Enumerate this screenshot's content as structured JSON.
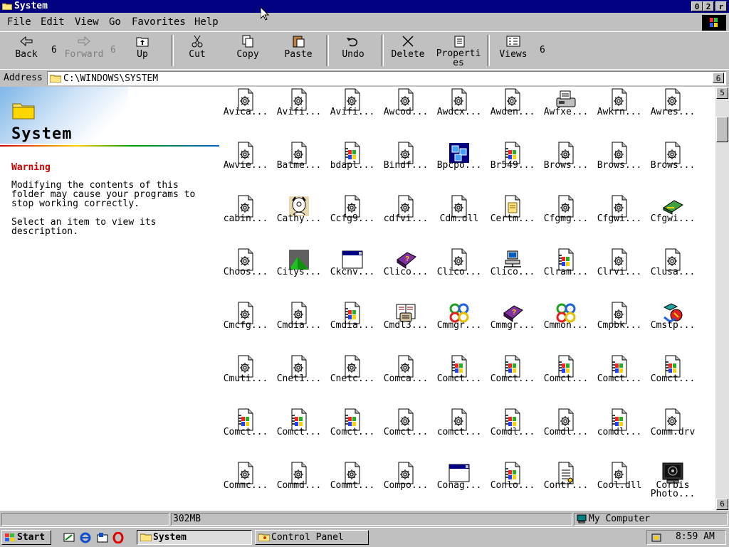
{
  "window": {
    "title": "System",
    "controls": [
      "0",
      "2",
      "r"
    ]
  },
  "menu": [
    "File",
    "Edit",
    "View",
    "Go",
    "Favorites",
    "Help"
  ],
  "toolbar": {
    "back": "Back",
    "back_arrow": "6",
    "forward": "Forward",
    "forward_arrow": "6",
    "up": "Up",
    "cut": "Cut",
    "copy": "Copy",
    "paste": "Paste",
    "undo": "Undo",
    "delete": "Delete",
    "properties": "Properties",
    "views": "Views",
    "views_arrow": "6"
  },
  "address": {
    "label": "Address",
    "path": "C:\\WINDOWS\\SYSTEM",
    "dropdown": "6"
  },
  "side_panel": {
    "title": "System",
    "warning_label": "Warning",
    "warning_text": "Modifying the contents of this folder may cause your programs to stop working correctly.",
    "hint_text": "Select an item to view its description."
  },
  "files": [
    {
      "name": "Avica...",
      "icon": "gear-doc"
    },
    {
      "name": "Avifi...",
      "icon": "gear-doc"
    },
    {
      "name": "Avifi...",
      "icon": "gear-doc"
    },
    {
      "name": "Awcod...",
      "icon": "gear-doc"
    },
    {
      "name": "Awdcx...",
      "icon": "gear-doc"
    },
    {
      "name": "Awden...",
      "icon": "gear-doc"
    },
    {
      "name": "Awfxe...",
      "icon": "fax"
    },
    {
      "name": "Awkrn...",
      "icon": "gear-doc"
    },
    {
      "name": "Awres...",
      "icon": "gear-doc"
    },
    {
      "name": "Awvie...",
      "icon": "gear-doc"
    },
    {
      "name": "Batme...",
      "icon": "gear-doc"
    },
    {
      "name": "bdapl...",
      "icon": "win-doc"
    },
    {
      "name": "Bindf...",
      "icon": "gear-doc"
    },
    {
      "name": "Bpcpo...",
      "icon": "blue-cubes"
    },
    {
      "name": "Br549...",
      "icon": "win-doc"
    },
    {
      "name": "Brows...",
      "icon": "gear-doc"
    },
    {
      "name": "Brows...",
      "icon": "gear-doc"
    },
    {
      "name": "Brows...",
      "icon": "gear-doc"
    },
    {
      "name": "cabin...",
      "icon": "gear-doc"
    },
    {
      "name": "Cathy...",
      "icon": "cathy"
    },
    {
      "name": "Ccfg9...",
      "icon": "gear-doc"
    },
    {
      "name": "cdfvi...",
      "icon": "gear-doc"
    },
    {
      "name": "Cdm.dll",
      "icon": "gear-doc"
    },
    {
      "name": "Certm...",
      "icon": "cert-doc"
    },
    {
      "name": "Cfgmg...",
      "icon": "gear-doc"
    },
    {
      "name": "Cfgwi...",
      "icon": "gear-doc"
    },
    {
      "name": "Cfgwi...",
      "icon": "card"
    },
    {
      "name": "Choos...",
      "icon": "gear-doc"
    },
    {
      "name": "Citys...",
      "icon": "citys"
    },
    {
      "name": "Ckcnv...",
      "icon": "window"
    },
    {
      "name": "Clico...",
      "icon": "help-book"
    },
    {
      "name": "Clico...",
      "icon": "gear-doc"
    },
    {
      "name": "Clico...",
      "icon": "network-pc"
    },
    {
      "name": "Clram...",
      "icon": "win-doc"
    },
    {
      "name": "Clrvi...",
      "icon": "gear-doc"
    },
    {
      "name": "Clusa...",
      "icon": "gear-doc"
    },
    {
      "name": "Cmcfg...",
      "icon": "gear-doc"
    },
    {
      "name": "Cmdia...",
      "icon": "gear-doc"
    },
    {
      "name": "Cmdia...",
      "icon": "win-doc"
    },
    {
      "name": "Cmdl3...",
      "icon": "phonebook"
    },
    {
      "name": "Cmmgr...",
      "icon": "knot"
    },
    {
      "name": "Cmmgr...",
      "icon": "help-book"
    },
    {
      "name": "Cmmon...",
      "icon": "knot"
    },
    {
      "name": "Cmpbk...",
      "icon": "gear-doc"
    },
    {
      "name": "Cmstp...",
      "icon": "setup"
    },
    {
      "name": "Cmuti...",
      "icon": "gear-doc"
    },
    {
      "name": "Cnet1...",
      "icon": "gear-doc"
    },
    {
      "name": "Cnetc...",
      "icon": "gear-doc"
    },
    {
      "name": "Comca...",
      "icon": "gear-doc"
    },
    {
      "name": "Comct...",
      "icon": "win-doc"
    },
    {
      "name": "Comct...",
      "icon": "win-doc"
    },
    {
      "name": "Comct...",
      "icon": "win-doc"
    },
    {
      "name": "Comct...",
      "icon": "win-doc"
    },
    {
      "name": "Comct...",
      "icon": "win-doc"
    },
    {
      "name": "Comct...",
      "icon": "win-doc"
    },
    {
      "name": "Comct...",
      "icon": "win-doc"
    },
    {
      "name": "Comct...",
      "icon": "win-doc"
    },
    {
      "name": "Comct...",
      "icon": "gear-doc"
    },
    {
      "name": "comct...",
      "icon": "gear-doc"
    },
    {
      "name": "Comdl...",
      "icon": "win-doc"
    },
    {
      "name": "Comdl...",
      "icon": "gear-doc"
    },
    {
      "name": "comdl...",
      "icon": "win-doc"
    },
    {
      "name": "Comm.drv",
      "icon": "gear-doc"
    },
    {
      "name": "Commc...",
      "icon": "gear-doc"
    },
    {
      "name": "Commd...",
      "icon": "gear-doc"
    },
    {
      "name": "Commt...",
      "icon": "gear-doc"
    },
    {
      "name": "Compo...",
      "icon": "gear-doc"
    },
    {
      "name": "Conag...",
      "icon": "window"
    },
    {
      "name": "Conlo...",
      "icon": "win-doc"
    },
    {
      "name": "Contr...",
      "icon": "text-doc"
    },
    {
      "name": "Cool.dll",
      "icon": "gear-doc"
    },
    {
      "name": "Corbis\nPhoto...",
      "icon": "monitor"
    }
  ],
  "status": {
    "size": "302MB",
    "location": "My Computer"
  },
  "taskbar": {
    "start": "Start",
    "tasks": [
      "System",
      "Control Panel"
    ],
    "clock": "8:59 AM"
  },
  "scrollbar": {
    "up": "5",
    "down": "6"
  }
}
